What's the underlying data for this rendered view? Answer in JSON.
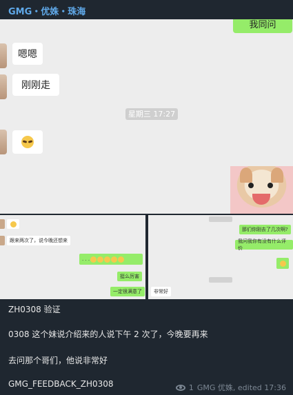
{
  "header": {
    "title": "GMG・优姝・珠海"
  },
  "chat": {
    "top_right_bubble": "我同问",
    "msg1": "嗯嗯",
    "msg2": "刚刚走",
    "timestamp": "星期三 17:27",
    "emoji_name": "cool-face-emoji"
  },
  "strip_left": {
    "msg1": "跟来两次了，说今晚还想来",
    "msg2": ". . .",
    "msg3": "挺么厉害",
    "msg4": "一定很满意了"
  },
  "strip_right": {
    "msg1": "那们你刚去了几次啊?",
    "msg2": "我问我你有没有什么评价",
    "msg3": "非常好"
  },
  "caption": {
    "line1": "ZH0308 验证",
    "line2": "0308 这个妹说介绍来的人说下午 2 次了，今晚要再来",
    "line3": "去问那个哥们，他说非常好",
    "line4": "GMG_FEEDBACK_ZH0308",
    "views": "1",
    "author": "GMG 优姝, edited 17:36"
  }
}
